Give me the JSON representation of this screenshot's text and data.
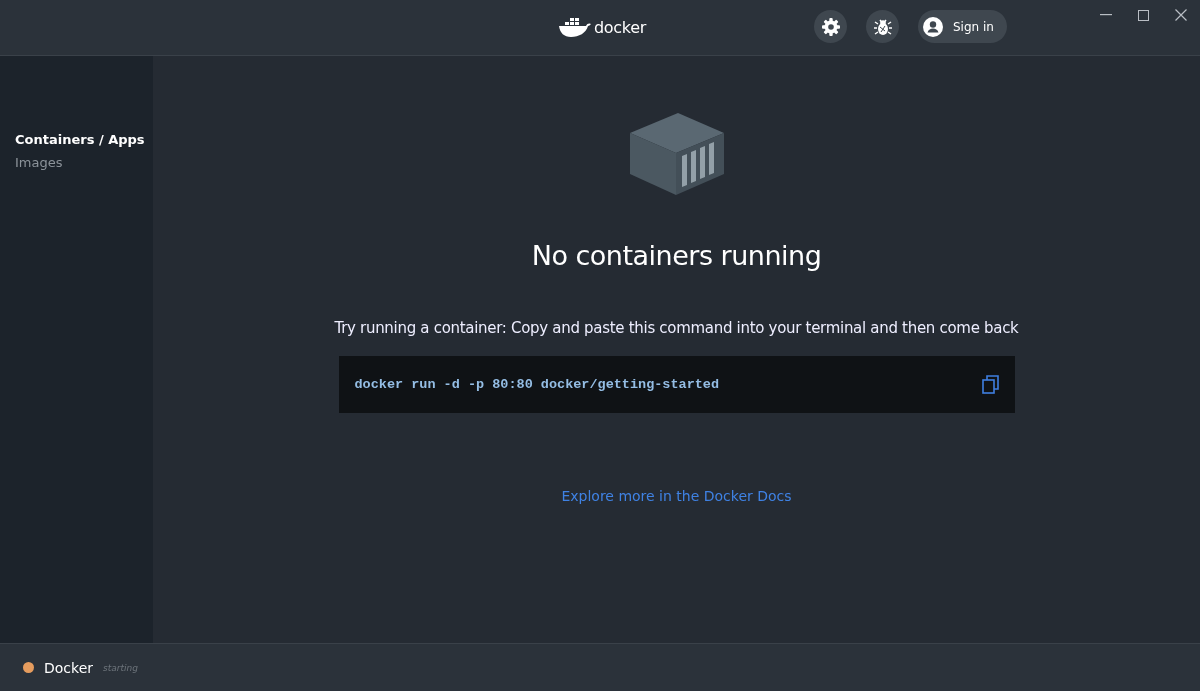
{
  "header": {
    "logo_text": "docker",
    "sign_in": "Sign in"
  },
  "sidebar": {
    "items": [
      {
        "label": "Containers / Apps",
        "selected": true
      },
      {
        "label": "Images",
        "selected": false
      }
    ]
  },
  "main": {
    "title": "No containers running",
    "instruction": "Try running a container: Copy and paste this command into your terminal and then come back",
    "command": "docker run -d -p 80:80 docker/getting-started",
    "link": "Explore more in the Docker Docs"
  },
  "status_bar": {
    "name": "Docker",
    "state": "starting",
    "color": "#e59c5e"
  }
}
